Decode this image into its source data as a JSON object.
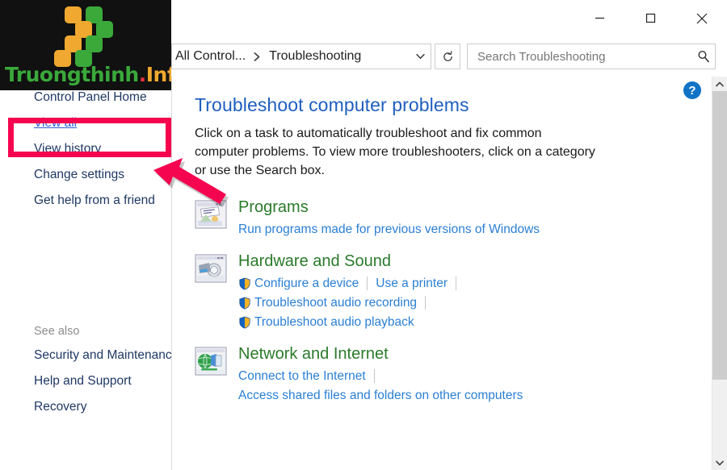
{
  "window": {
    "controls": {
      "minimize_label": "Minimize",
      "maximize_label": "Maximize",
      "close_label": "Close"
    }
  },
  "watermark": {
    "text_part1": "Truongthinh",
    "text_dot": ".",
    "text_part2": "Info",
    "colors": {
      "green": "#3aa93a",
      "orange": "#f0a830",
      "red": "#e8333a",
      "background": "#111111"
    }
  },
  "addressbar": {
    "crumbs": [
      {
        "label": "All Control..."
      },
      {
        "label": "Troubleshooting"
      }
    ],
    "separator": "❯",
    "dropdown_icon": "chevron-down-icon",
    "refresh_icon": "refresh-icon",
    "refresh_label": "↻"
  },
  "search": {
    "placeholder": "Search Troubleshooting",
    "value": "",
    "icon": "search-icon"
  },
  "sidebar": {
    "items": [
      {
        "label": "Control Panel Home",
        "highlighted": false
      },
      {
        "label": "View all",
        "highlighted": true
      },
      {
        "label": "View history",
        "highlighted": false
      },
      {
        "label": "Change settings",
        "highlighted": false
      },
      {
        "label": "Get help from a friend",
        "highlighted": false
      }
    ],
    "see_also_label": "See also",
    "see_also_items": [
      {
        "label": "Security and Maintenance"
      },
      {
        "label": "Help and Support"
      },
      {
        "label": "Recovery"
      }
    ]
  },
  "annotation": {
    "highlight_color": "#f5054f",
    "target": "View all",
    "arrow_icon": "pointer-arrow-icon"
  },
  "main": {
    "help_button_label": "?",
    "title": "Troubleshoot computer problems",
    "description": "Click on a task to automatically troubleshoot and fix common computer problems. To view more troubleshooters, click on a category or use the Search box.",
    "categories": [
      {
        "title": "Programs",
        "icon": "programs-icon",
        "task_rows": [
          [
            {
              "label": "Run programs made for previous versions of Windows",
              "shield": false,
              "trailing_sep": false
            }
          ]
        ]
      },
      {
        "title": "Hardware and Sound",
        "icon": "hardware-and-sound-icon",
        "task_rows": [
          [
            {
              "label": "Configure a device",
              "shield": true,
              "trailing_sep": true
            },
            {
              "label": "Use a printer",
              "shield": false,
              "trailing_sep": true
            }
          ],
          [
            {
              "label": "Troubleshoot audio recording",
              "shield": true,
              "trailing_sep": true
            }
          ],
          [
            {
              "label": "Troubleshoot audio playback",
              "shield": true,
              "trailing_sep": false
            }
          ]
        ]
      },
      {
        "title": "Network and Internet",
        "icon": "network-and-internet-icon",
        "task_rows": [
          [
            {
              "label": "Connect to the Internet",
              "shield": false,
              "trailing_sep": true
            }
          ],
          [
            {
              "label": "Access shared files and folders on other computers",
              "shield": false,
              "trailing_sep": false
            }
          ]
        ]
      }
    ]
  },
  "scrollbar": {
    "up_icon": "chevron-up-icon",
    "down_icon": "chevron-down-icon"
  }
}
